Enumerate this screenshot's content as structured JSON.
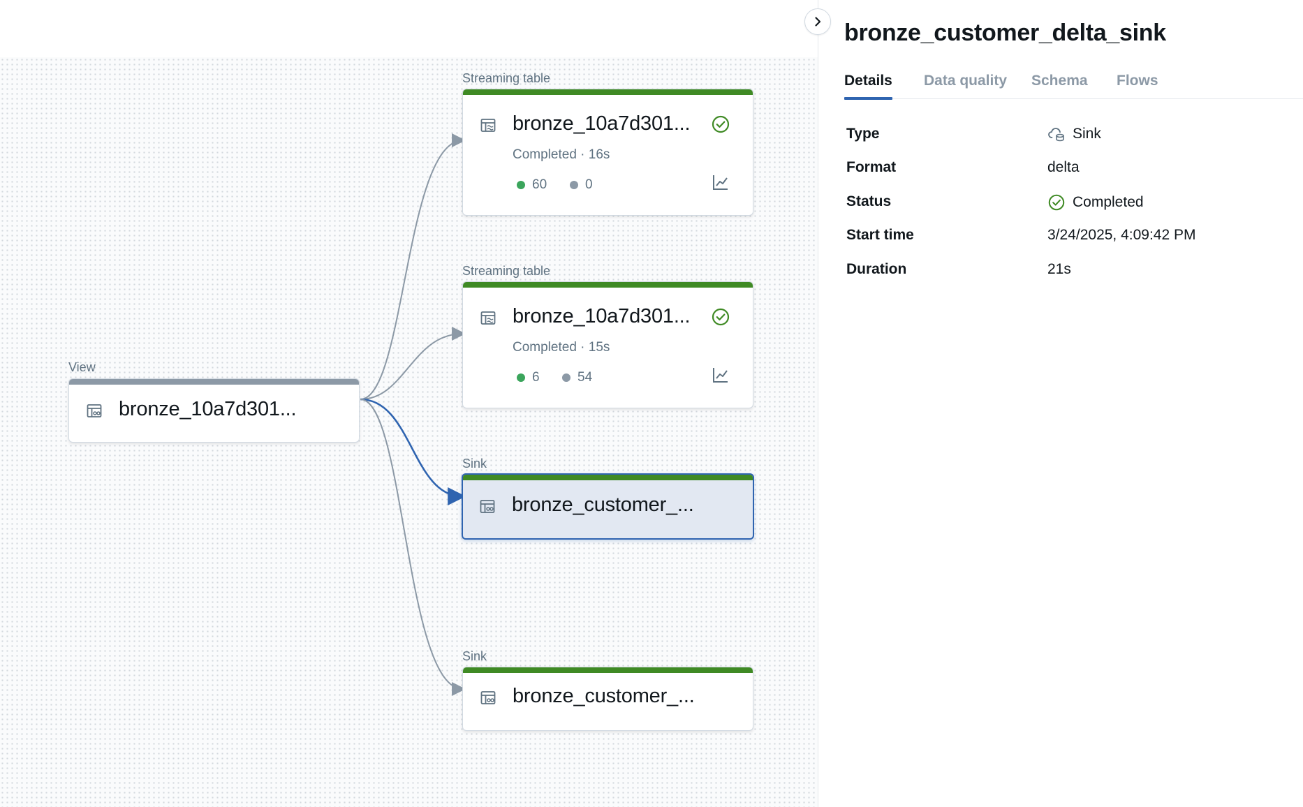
{
  "graph": {
    "nodes": [
      {
        "id": "view",
        "type_label": "View",
        "title": "bronze_10a7d301...",
        "bar": "gray"
      },
      {
        "id": "st1",
        "type_label": "Streaming table",
        "title": "bronze_10a7d301...",
        "status": "Completed · 16s",
        "metric_a": "60",
        "metric_b": "0",
        "bar": "green"
      },
      {
        "id": "st2",
        "type_label": "Streaming table",
        "title": "bronze_10a7d301...",
        "status": "Completed · 15s",
        "metric_a": "6",
        "metric_b": "54",
        "bar": "green"
      },
      {
        "id": "sink1",
        "type_label": "Sink",
        "title": "bronze_customer_...",
        "bar": "green",
        "selected": true
      },
      {
        "id": "sink2",
        "type_label": "Sink",
        "title": "bronze_customer_...",
        "bar": "green"
      }
    ]
  },
  "panel": {
    "title": "bronze_customer_delta_sink",
    "tabs": [
      {
        "label": "Details",
        "active": true
      },
      {
        "label": "Data quality"
      },
      {
        "label": "Schema"
      },
      {
        "label": "Flows"
      }
    ],
    "details": {
      "type_key": "Type",
      "type_val": "Sink",
      "format_key": "Format",
      "format_val": "delta",
      "status_key": "Status",
      "status_val": "Completed",
      "start_key": "Start time",
      "start_val": "3/24/2025, 4:09:42 PM",
      "duration_key": "Duration",
      "duration_val": "21s"
    }
  },
  "colors": {
    "success": "#3f8a24",
    "selected": "#2f64b0",
    "edge": "#8c99a6"
  },
  "icons": {
    "collapse": "chevron-right-icon",
    "table": "table-icon",
    "check": "check-circle-icon",
    "chart": "line-chart-icon",
    "sink": "cloud-sink-icon"
  }
}
